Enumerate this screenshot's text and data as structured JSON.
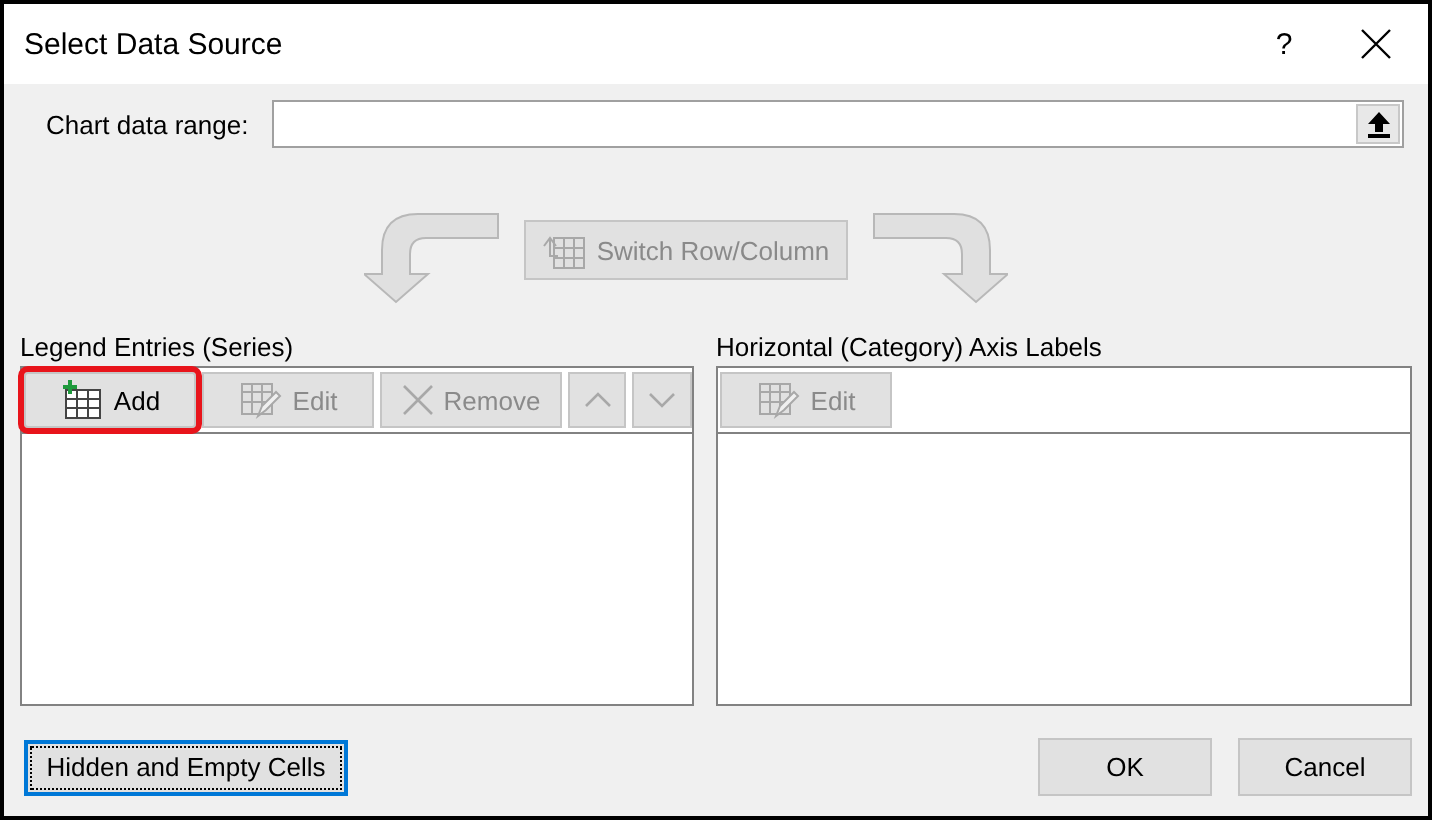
{
  "window": {
    "title": "Select Data Source",
    "help": "?"
  },
  "chart_data_range": {
    "label": "Chart data range:"
  },
  "switch_button": {
    "label": "Switch Row/Column",
    "disabled": true
  },
  "legend_entries": {
    "title": "Legend Entries (Series)",
    "buttons": [
      {
        "kind": "add",
        "label": "Add",
        "disabled": false,
        "highlighted": true
      },
      {
        "kind": "edit",
        "label": "Edit",
        "disabled": true,
        "highlighted": false
      },
      {
        "kind": "remove",
        "label": "Remove",
        "disabled": true,
        "highlighted": false
      },
      {
        "kind": "up",
        "disabled": true,
        "highlighted": false
      },
      {
        "kind": "down",
        "disabled": true,
        "highlighted": false
      }
    ]
  },
  "axis_labels": {
    "title": "Horizontal (Category) Axis Labels",
    "buttons": [
      {
        "kind": "edit",
        "label": "Edit",
        "disabled": true,
        "highlighted": false
      }
    ]
  },
  "footer": {
    "hidden_cells_button": {
      "label": "Hidden and Empty Cells",
      "focused": true
    },
    "buttons": [
      {
        "label": "OK"
      },
      {
        "label": "Cancel"
      }
    ]
  }
}
